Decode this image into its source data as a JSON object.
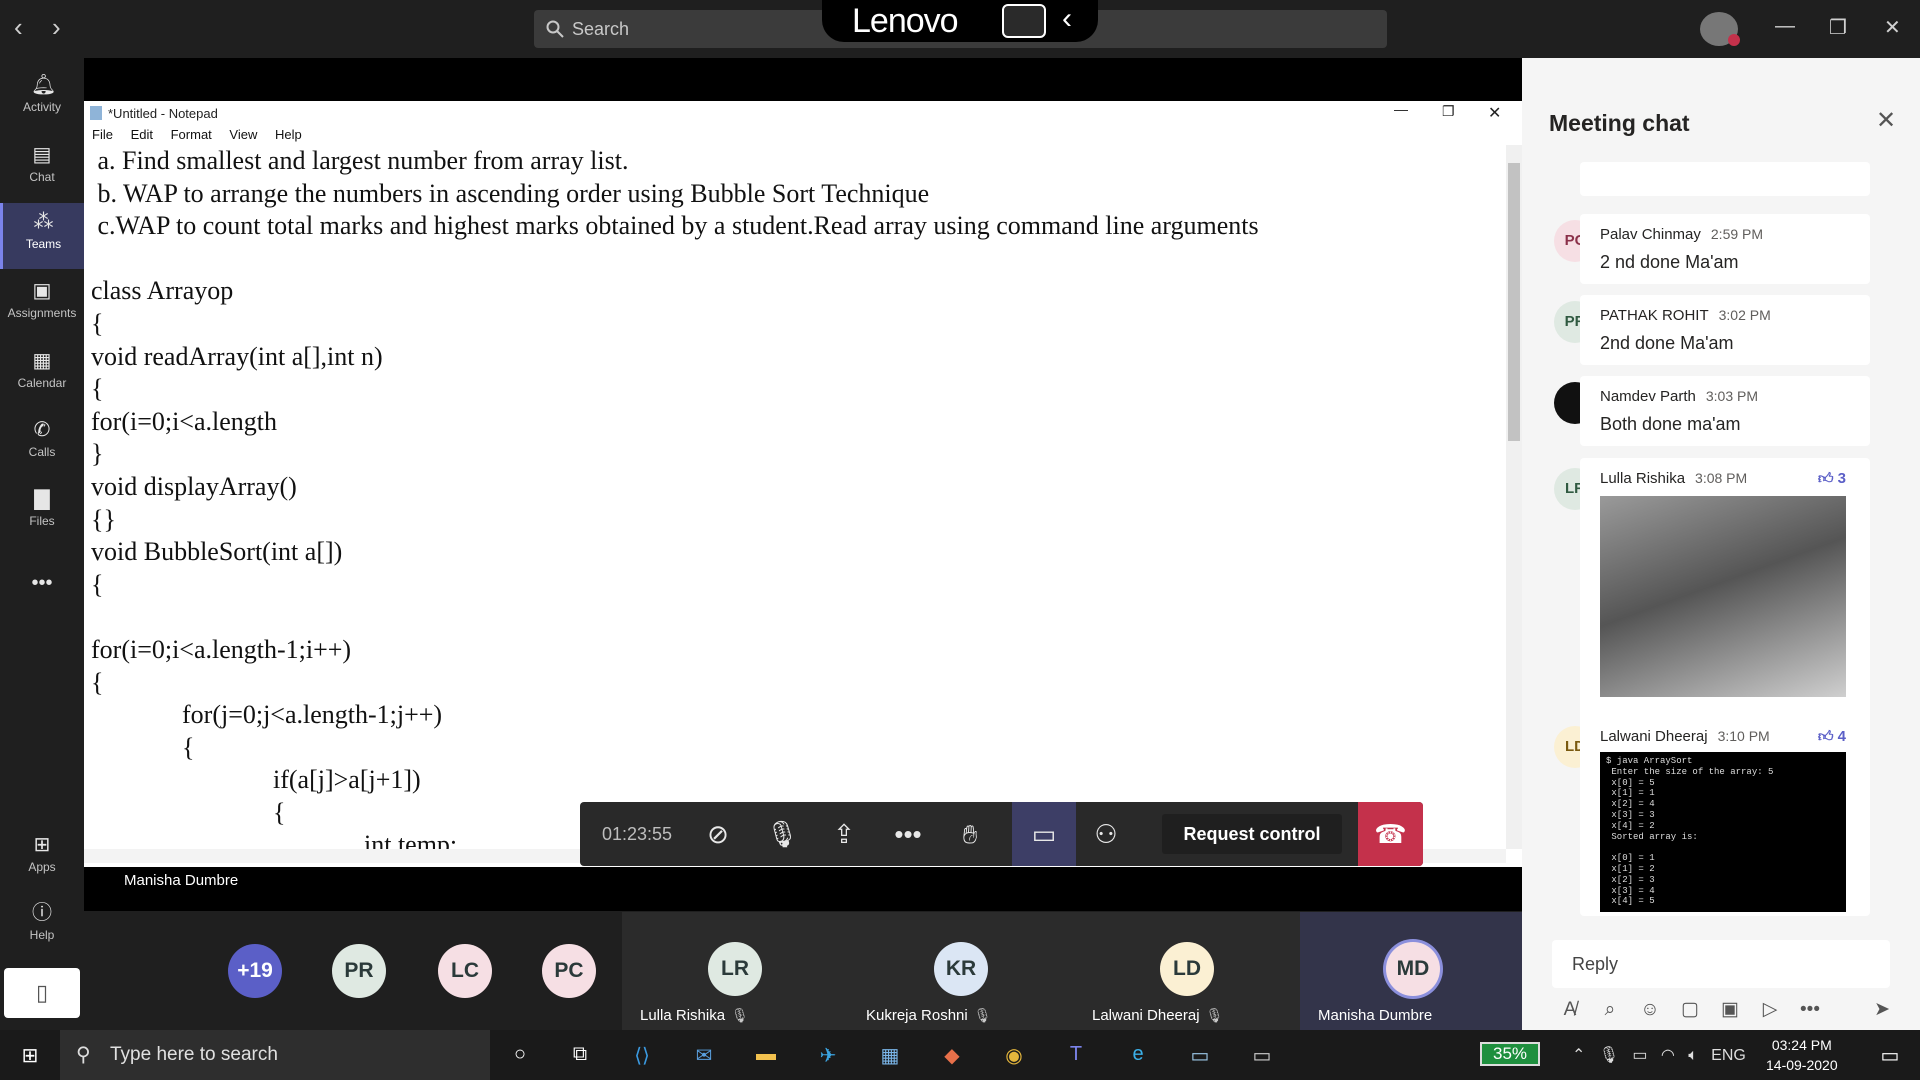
{
  "topbar": {
    "search_placeholder": "Search",
    "brand": "Lenovo"
  },
  "rail": [
    {
      "label": "Activity",
      "icon": "bell-icon"
    },
    {
      "label": "Chat",
      "icon": "chat-icon"
    },
    {
      "label": "Teams",
      "icon": "teams-icon"
    },
    {
      "label": "Assignments",
      "icon": "assignments-icon"
    },
    {
      "label": "Calendar",
      "icon": "calendar-icon"
    },
    {
      "label": "Calls",
      "icon": "phone-icon"
    },
    {
      "label": "Files",
      "icon": "files-icon"
    },
    {
      "label": "Apps",
      "icon": "apps-icon"
    },
    {
      "label": "Help",
      "icon": "help-icon"
    }
  ],
  "notepad": {
    "title": "*Untitled - Notepad",
    "menu": [
      "File",
      "Edit",
      "Format",
      "View",
      "Help"
    ],
    "text": " a. Find smallest and largest number from array list.\n b. WAP to arrange the numbers in ascending order using Bubble Sort Technique\n c.WAP to count total marks and highest marks obtained by a student.Read array using command line arguments\n\nclass Arrayop\n{\nvoid readArray(int a[],int n)\n{\nfor(i=0;i<a.length\n}\nvoid displayArray()\n{}\nvoid BubbleSort(int a[])\n{\n\nfor(i=0;i<a.length-1;i++)\n{\n              for(j=0;j<a.length-1;j++)\n              {\n                            if(a[j]>a[j+1])\n                            {\n                                          int temp;"
  },
  "call": {
    "timer": "01:23:55",
    "request_control": "Request control",
    "presenter": "Manisha Dumbre"
  },
  "participants": {
    "overflow": "+19",
    "small": [
      "PR",
      "LC",
      "PC"
    ],
    "tiles": [
      {
        "initials": "LR",
        "name": "Lulla Rishika",
        "color": "#dfe9e2"
      },
      {
        "initials": "KR",
        "name": "Kukreja Roshni",
        "color": "#dbe6f4"
      },
      {
        "initials": "LD",
        "name": "Lalwani Dheeraj",
        "color": "#fbf0d3"
      },
      {
        "initials": "MD",
        "name": "Manisha Dumbre",
        "color": "#f6dfe4"
      }
    ]
  },
  "chat": {
    "title": "Meeting chat",
    "messages": [
      {
        "initials": "PC",
        "author": "Palav Chinmay",
        "time": "2:59 PM",
        "text": "2 nd done Ma'am"
      },
      {
        "initials": "PR",
        "author": "PATHAK ROHIT",
        "time": "3:02 PM",
        "text": "2nd done Ma'am"
      },
      {
        "initials": "",
        "author": "Namdev Parth",
        "time": "3:03 PM",
        "text": "Both done ma'am"
      },
      {
        "initials": "LR",
        "author": "Lulla Rishika",
        "time": "3:08 PM",
        "reaction": "3"
      },
      {
        "initials": "LD",
        "author": "Lalwani Dheeraj",
        "time": "3:10 PM",
        "reaction": "4"
      }
    ],
    "terminal_lines": "$ java ArraySort\n Enter the size of the array: 5\n x[0] = 5\n x[1] = 1\n x[2] = 4\n x[3] = 3\n x[4] = 2\n Sorted array is:\n\n x[0] = 1\n x[1] = 2\n x[2] = 3\n x[3] = 4\n x[4] = 5",
    "reply_placeholder": "Reply"
  },
  "taskbar": {
    "search_placeholder": "Type here to search",
    "battery": "35%",
    "lang": "ENG",
    "time": "03:24 PM",
    "date": "14-09-2020"
  }
}
